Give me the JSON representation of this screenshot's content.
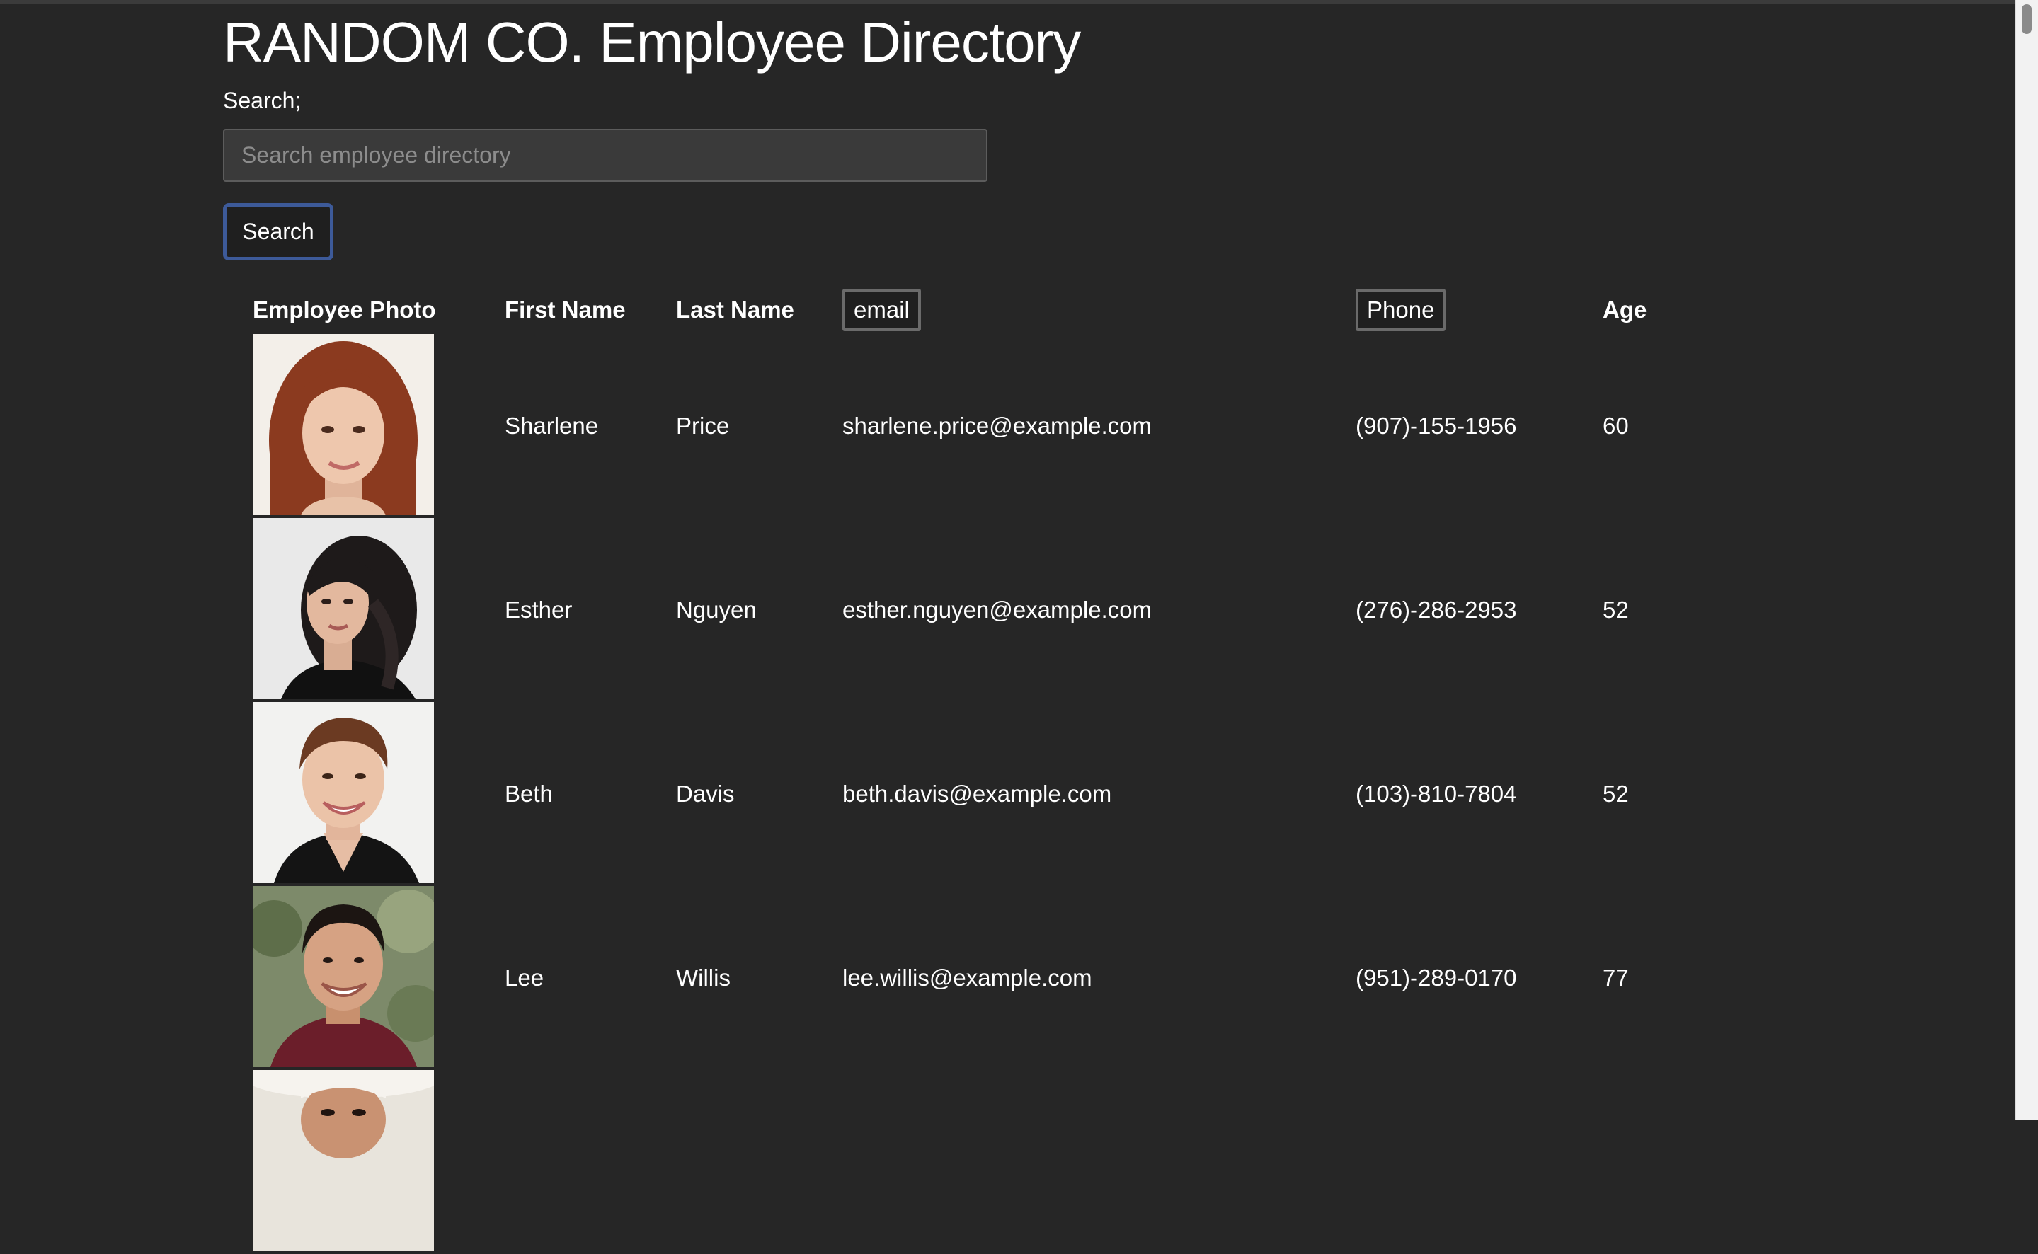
{
  "page": {
    "title": "RANDOM CO. Employee Directory"
  },
  "search": {
    "label": "Search;",
    "placeholder": "Search employee directory",
    "value": "",
    "button_label": "Search"
  },
  "table": {
    "headers": {
      "photo": "Employee Photo",
      "first_name": "First Name",
      "last_name": "Last Name",
      "email": "email",
      "phone": "Phone",
      "age": "Age"
    },
    "rows": [
      {
        "first_name": "Sharlene",
        "last_name": "Price",
        "email": "sharlene.price@example.com",
        "phone": "(907)-155-1956",
        "age": "60"
      },
      {
        "first_name": "Esther",
        "last_name": "Nguyen",
        "email": "esther.nguyen@example.com",
        "phone": "(276)-286-2953",
        "age": "52"
      },
      {
        "first_name": "Beth",
        "last_name": "Davis",
        "email": "beth.davis@example.com",
        "phone": "(103)-810-7804",
        "age": "52"
      },
      {
        "first_name": "Lee",
        "last_name": "Willis",
        "email": "lee.willis@example.com",
        "phone": "(951)-289-0170",
        "age": "77"
      },
      {
        "first_name": "",
        "last_name": "",
        "email": "",
        "phone": "",
        "age": ""
      }
    ]
  },
  "colors": {
    "background": "#262626",
    "text": "#ffffff",
    "button_focus_ring": "#3d5a99",
    "input_background": "#3a3a3a"
  }
}
